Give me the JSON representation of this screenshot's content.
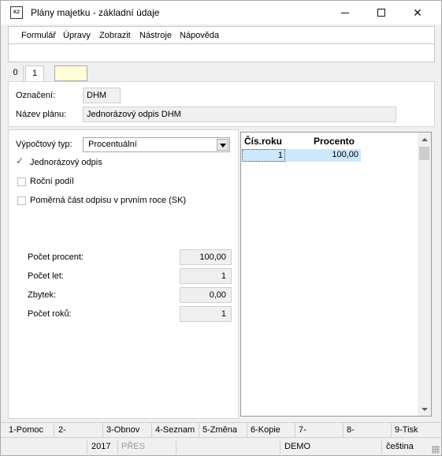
{
  "window": {
    "title": "Plány majetku - základní údaje",
    "icon_text": "K2"
  },
  "menu": {
    "items": [
      "Formulář",
      "Úpravy",
      "Zobrazit",
      "Nástroje",
      "Nápověda"
    ]
  },
  "tabs": [
    "0",
    "1"
  ],
  "header": {
    "oznaceni_label": "Označení:",
    "oznaceni_value": "DHM",
    "nazev_label": "Název plánu:",
    "nazev_value": "Jednorázový odpis DHM"
  },
  "left": {
    "vypoctovy_label": "Výpočtový typ:",
    "vypoctovy_value": "Procentuální",
    "checkboxes": [
      {
        "label": "Jednorázový odpis",
        "checked": true
      },
      {
        "label": "Roční podíl",
        "checked": false
      },
      {
        "label": "Poměrná část odpisu v prvním roce (SK)",
        "checked": false
      }
    ],
    "fields": [
      {
        "label": "Počet procent:",
        "value": "100,00"
      },
      {
        "label": "Počet let:",
        "value": "1"
      },
      {
        "label": "Zbytek:",
        "value": "0,00"
      },
      {
        "label": "Počet roků:",
        "value": "1"
      }
    ]
  },
  "grid": {
    "headers": [
      "Čís.roku",
      "Procento"
    ],
    "rows": [
      [
        "1",
        "100,00"
      ]
    ]
  },
  "fkeys": [
    "1-Pomoc",
    "2-",
    "3-Obnov",
    "4-Seznam",
    "5-Změna",
    "6-Kopie",
    "7-",
    "8-",
    "9-Tisk"
  ],
  "status": {
    "year": "2017",
    "mode": "PŘES",
    "db": "DEMO",
    "lang": "čeština"
  }
}
